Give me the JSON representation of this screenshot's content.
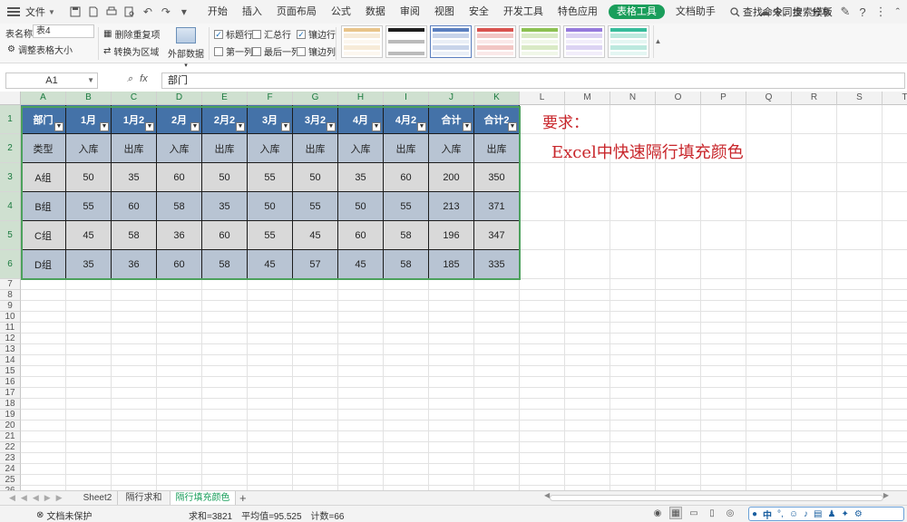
{
  "menubar": {
    "file": "文件",
    "tabs": [
      "开始",
      "插入",
      "页面布局",
      "公式",
      "数据",
      "审阅",
      "视图",
      "安全",
      "开发工具",
      "特色应用",
      "表格工具",
      "文档助手"
    ],
    "active_tab": "表格工具",
    "search": "查找命令、搜索模板",
    "sync": "未同步",
    "share": "分享"
  },
  "ribbon": {
    "table_name_label": "表名称:",
    "table_name_value": "表4",
    "resize": "调整表格大小",
    "remove_duplicates": "删除重复项",
    "convert_to_range": "转换为区域",
    "external_data": "外部数据",
    "checkboxes": [
      {
        "label": "标题行",
        "checked": true
      },
      {
        "label": "汇总行",
        "checked": false
      },
      {
        "label": "镶边行",
        "checked": true
      },
      {
        "label": "第一列",
        "checked": false
      },
      {
        "label": "最后一列",
        "checked": false
      },
      {
        "label": "镶边列",
        "checked": false
      }
    ],
    "style_colors": [
      "#e8c48a",
      "#1e1e1e",
      "#5b7fbf",
      "#d9534f",
      "#8cc152",
      "#967adc",
      "#37bc9b"
    ]
  },
  "formula_bar": {
    "name_box": "A1",
    "fx": "fx",
    "value": "部门"
  },
  "grid": {
    "columns": [
      "A",
      "B",
      "C",
      "D",
      "E",
      "F",
      "G",
      "H",
      "I",
      "J",
      "K",
      "L",
      "M",
      "N",
      "O",
      "P",
      "Q",
      "R",
      "S",
      "T"
    ],
    "row_numbers": [
      "1",
      "2",
      "3",
      "4",
      "5",
      "6",
      "7",
      "8",
      "9",
      "10",
      "11",
      "12",
      "13",
      "14",
      "15",
      "16",
      "17",
      "18",
      "19",
      "20",
      "21",
      "22",
      "23",
      "24",
      "25",
      "26"
    ],
    "header_row": [
      "部门",
      "1月",
      "1月2",
      "2月",
      "2月2",
      "3月",
      "3月2",
      "4月",
      "4月2",
      "合计",
      "合计2"
    ],
    "rows": [
      [
        "类型",
        "入库",
        "出库",
        "入库",
        "出库",
        "入库",
        "出库",
        "入库",
        "出库",
        "入库",
        "出库"
      ],
      [
        "A组",
        "50",
        "35",
        "60",
        "50",
        "55",
        "50",
        "35",
        "60",
        "200",
        "350"
      ],
      [
        "B组",
        "55",
        "60",
        "58",
        "35",
        "50",
        "55",
        "50",
        "55",
        "213",
        "371"
      ],
      [
        "C组",
        "45",
        "58",
        "36",
        "60",
        "55",
        "45",
        "60",
        "58",
        "196",
        "347"
      ],
      [
        "D组",
        "35",
        "36",
        "60",
        "58",
        "45",
        "57",
        "45",
        "58",
        "185",
        "335"
      ]
    ],
    "note_title": "要求：",
    "note_body": "Excel中快速隔行填充颜色"
  },
  "sheets": {
    "tabs": [
      "Sheet2",
      "隔行求和",
      "隔行填充颜色"
    ],
    "active": "隔行填充颜色"
  },
  "status": {
    "protect": "文档未保护",
    "sum": "求和=3821",
    "avg": "平均值=95.525",
    "count": "计数=66",
    "ime": "中"
  }
}
